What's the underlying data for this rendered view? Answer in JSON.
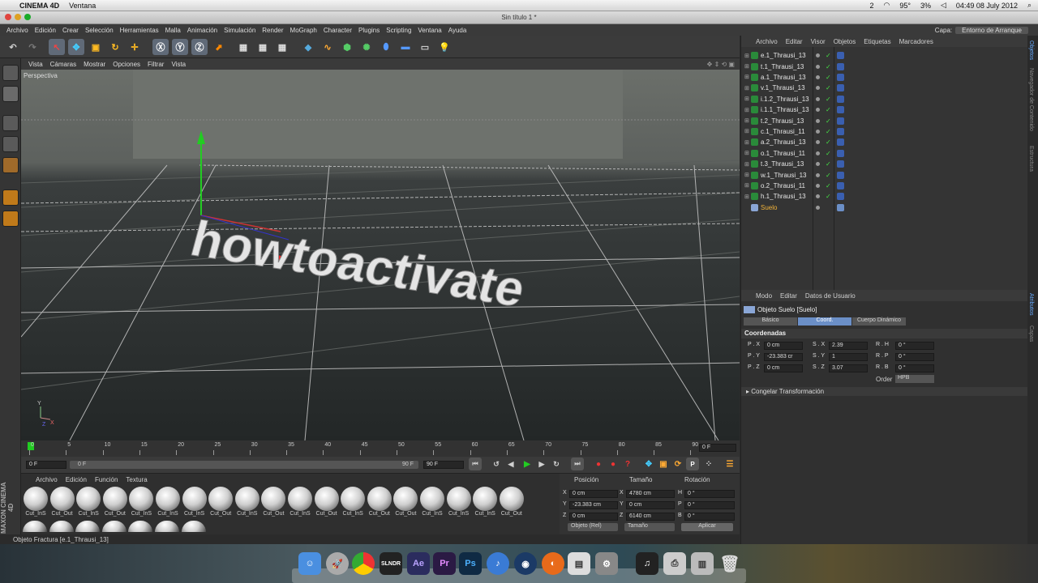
{
  "mac_menubar": {
    "apple": "",
    "app": "CINEMA 4D",
    "window_menu": "Ventana",
    "status": {
      "temp": "95°",
      "battery": "3%",
      "datetime": "04:49 08 July 2012",
      "indicator": "2"
    }
  },
  "window": {
    "title": "Sin título 1 *"
  },
  "main_menu": [
    "Archivo",
    "Edición",
    "Crear",
    "Selección",
    "Herramientas",
    "Malla",
    "Animación",
    "Simulación",
    "Render",
    "MoGraph",
    "Character",
    "Plugins",
    "Scripting",
    "Ventana",
    "Ayuda"
  ],
  "layout": {
    "label": "Capa:",
    "value": "Entorno de Arranque"
  },
  "viewport": {
    "menu": [
      "Vista",
      "Cámaras",
      "Mostrar",
      "Opciones",
      "Filtrar",
      "Vista"
    ],
    "label": "Perspectiva",
    "text3d": "howtoactivate",
    "axes": {
      "y": "Y",
      "x": "X",
      "z": "Z"
    }
  },
  "timeline": {
    "ticks": [
      "0",
      "5",
      "10",
      "15",
      "20",
      "25",
      "30",
      "35",
      "40",
      "45",
      "50",
      "55",
      "60",
      "65",
      "70",
      "75",
      "80",
      "85",
      "90"
    ],
    "current_frame": "0 F",
    "start": "0 F",
    "slider_start": "0 F",
    "slider_end": "90 F",
    "end": "90 F"
  },
  "materials": {
    "menu": [
      "Archivo",
      "Edición",
      "Función",
      "Textura"
    ],
    "items": [
      "Cut_InS",
      "Cut_Out",
      "Cut_InS",
      "Cut_Out",
      "Cut_InS",
      "Cut_InS",
      "Cut_InS",
      "Cut_Out",
      "Cut_InS",
      "Cut_Out",
      "Cut_InS",
      "Cut_Out",
      "Cut_InS",
      "Cut_Out",
      "Cut_Out",
      "Cut_InS",
      "Cut_InS",
      "Cut_InS",
      "Cut_Out"
    ]
  },
  "coords": {
    "headers": [
      "Posición",
      "Tamaño",
      "Rotación"
    ],
    "rows": [
      {
        "axis": "X",
        "pos": "0 cm",
        "size_axis": "X",
        "size": "4780 cm",
        "rot_axis": "H",
        "rot": "0 °"
      },
      {
        "axis": "Y",
        "pos": "-23.383 cm",
        "size_axis": "Y",
        "size": "0 cm",
        "rot_axis": "P",
        "rot": "0 °"
      },
      {
        "axis": "Z",
        "pos": "0 cm",
        "size_axis": "Z",
        "size": "6140 cm",
        "rot_axis": "B",
        "rot": "0 °"
      }
    ],
    "mode": "Objeto (Rel)",
    "size_mode": "Tamaño",
    "apply": "Aplicar"
  },
  "status_text": "Objeto Fractura [e.1_Thrausi_13]",
  "objects_panel": {
    "menu": [
      "Archivo",
      "Editar",
      "Visor",
      "Objetos",
      "Etiquetas",
      "Marcadores"
    ],
    "items": [
      "e.1_Thrausi_13",
      "t.1_Thrausi_13",
      "a.1_Thrausi_13",
      "v.1_Thrausi_13",
      "i.1.2_Thrausi_13",
      "i.1.1_Thrausi_13",
      "t.2_Thrausi_13",
      "c.1_Thrausi_11",
      "a.2_Thrausi_13",
      "o.1_Thrausi_11",
      "t.3_Thrausi_13",
      "w.1_Thrausi_13",
      "o.2_Thrausi_11",
      "h.1_Thrausi_13",
      "Suelo"
    ]
  },
  "attributes": {
    "menu": [
      "Modo",
      "Editar",
      "Datos de Usuario"
    ],
    "object_title": "Objeto Suelo [Suelo]",
    "tabs": [
      "Básico",
      "Coord.",
      "Cuerpo Dinámico"
    ],
    "section": "Coordenadas",
    "rows": [
      {
        "p_label": "P . X",
        "p_val": "0 cm",
        "s_label": "S . X",
        "s_val": "2.39",
        "r_label": "R . H",
        "r_val": "0 °"
      },
      {
        "p_label": "P . Y",
        "p_val": "-23.383 cr",
        "s_label": "S . Y",
        "s_val": "1",
        "r_label": "R . P",
        "r_val": "0 °"
      },
      {
        "p_label": "P . Z",
        "p_val": "0 cm",
        "s_label": "S . Z",
        "s_val": "3.07",
        "r_label": "R . B",
        "r_val": "0 °"
      }
    ],
    "order_label": "Order",
    "order_value": "HPB",
    "freeze": "Congelar Transformación"
  },
  "side_tabs": [
    "Objetos",
    "Navegador de Contenido",
    "Estructura",
    "Atributos",
    "Capas"
  ],
  "brand": "MAXON CINEMA 4D",
  "dock": [
    "Finder",
    "Launchpad",
    "Chrome",
    "Slender",
    "Ae",
    "Pr",
    "Ps",
    "iTunes",
    "QuickTime",
    "Firefox",
    "Preview",
    "Settings",
    "Logic",
    "Printer",
    "Utilities",
    "Trash"
  ]
}
